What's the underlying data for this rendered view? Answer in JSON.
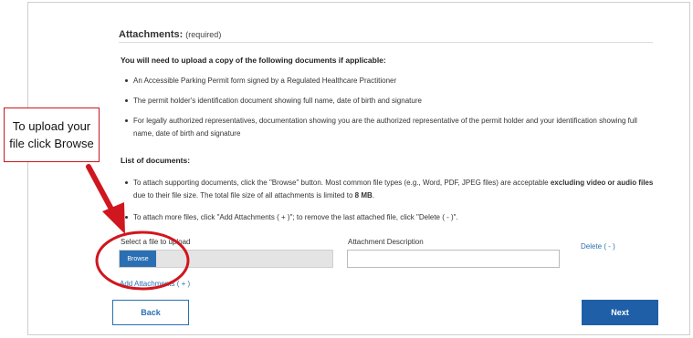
{
  "attachments": {
    "title": "Attachments:",
    "required_note": "(required)",
    "intro": "You will need to upload a copy of the following documents if applicable:",
    "requirements": [
      "An Accessible Parking Permit form signed by a Regulated Healthcare Practitioner",
      "The permit holder's identification document showing full name, date of birth and signature",
      "For legally authorized representatives, documentation showing you are the authorized representative of the permit holder and your identification showing full name, date of birth and signature"
    ],
    "list_heading": "List of documents:",
    "instructions": {
      "browse_prefix": "To attach supporting documents, click the \"Browse\" button. Most common file types (e.g., Word, PDF, JPEG files) are acceptable ",
      "browse_bold": "excluding video or audio files",
      "browse_mid": " due to their file size. The total file size of all attachments is limited to ",
      "browse_limit": "8 MB",
      "browse_end": ".",
      "add_remove": "To attach more files, click \"Add Attachments ( + )\"; to remove the last attached file, click \"Delete ( - )\"."
    },
    "select_file_label": "Select a file to upload",
    "browse_button": "Browse",
    "description_label": "Attachment Description",
    "description_value": "",
    "delete_link": "Delete ( - )",
    "add_link": "Add Attachments ( + )"
  },
  "navigation": {
    "back_label": "Back",
    "next_label": "Next"
  },
  "annotation": {
    "callout_text": "To upload your file click Browse",
    "highlight_color": "#d0161e"
  }
}
